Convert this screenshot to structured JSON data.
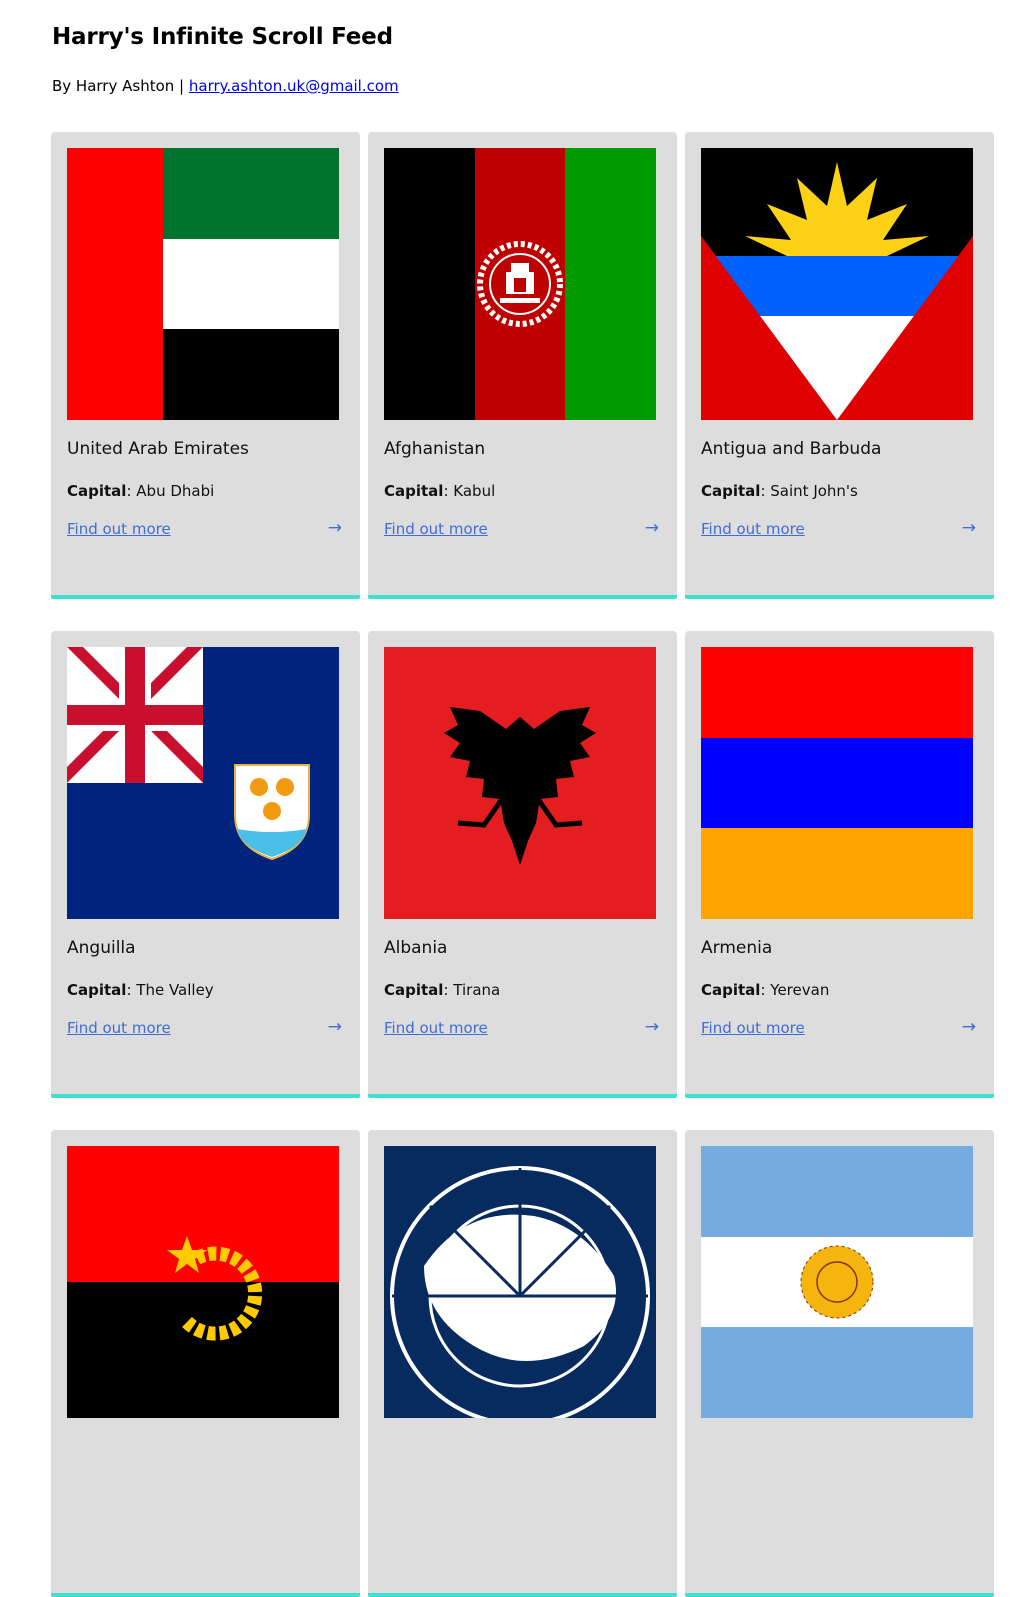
{
  "header": {
    "title": "Harry's Infinite Scroll Feed",
    "byline_prefix": "By Harry Ashton |",
    "email": "harry.ashton.uk@gmail.com"
  },
  "colors": {
    "card_bg": "#dddddd",
    "card_accent": "#40e0d0",
    "link": "#3f6cd7"
  },
  "cards": [
    {
      "name": "United Arab Emirates",
      "capital_label": "Capital",
      "capital": "Abu Dhabi",
      "link_label": "Find out more",
      "flag": "uae-flag-icon"
    },
    {
      "name": "Afghanistan",
      "capital_label": "Capital",
      "capital": "Kabul",
      "link_label": "Find out more",
      "flag": "afghanistan-flag-icon"
    },
    {
      "name": "Antigua and Barbuda",
      "capital_label": "Capital",
      "capital": "Saint John's",
      "link_label": "Find out more",
      "flag": "antigua-flag-icon"
    },
    {
      "name": "Anguilla",
      "capital_label": "Capital",
      "capital": "The Valley",
      "link_label": "Find out more",
      "flag": "anguilla-flag-icon"
    },
    {
      "name": "Albania",
      "capital_label": "Capital",
      "capital": "Tirana",
      "link_label": "Find out more",
      "flag": "albania-flag-icon"
    },
    {
      "name": "Armenia",
      "capital_label": "Capital",
      "capital": "Yerevan",
      "link_label": "Find out more",
      "flag": "armenia-flag-icon"
    },
    {
      "name": "",
      "capital_label": "",
      "capital": "",
      "link_label": "",
      "flag": "angola-flag-icon"
    },
    {
      "name": "",
      "capital_label": "",
      "capital": "",
      "link_label": "",
      "flag": "antarctica-flag-icon"
    },
    {
      "name": "",
      "capital_label": "",
      "capital": "",
      "link_label": "",
      "flag": "argentina-flag-icon"
    }
  ],
  "icons": {
    "arrow": "→"
  }
}
